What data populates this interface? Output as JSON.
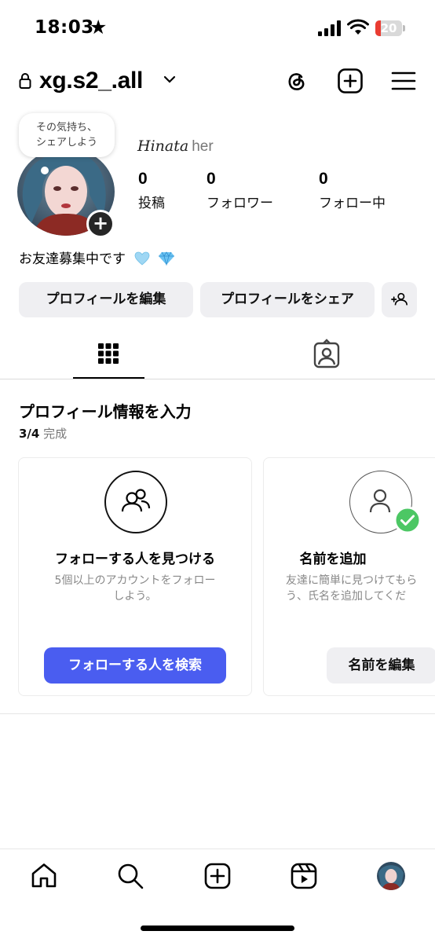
{
  "status_bar": {
    "time": "18:03",
    "battery": "20",
    "battery_level": 0.2
  },
  "header": {
    "username": "xg.s2_.all"
  },
  "profile": {
    "bubble_text": "その気持ち、\nシェアしよう",
    "display_name": "Hinata",
    "pronouns": "her",
    "stats": [
      {
        "value": "0",
        "label": "投稿"
      },
      {
        "value": "0",
        "label": "フォロワー"
      },
      {
        "value": "0",
        "label": "フォロー中"
      }
    ],
    "bio": "お友達募集中です",
    "buttons": {
      "edit": "プロフィールを編集",
      "share": "プロフィールをシェア"
    }
  },
  "completion": {
    "title": "プロフィール情報を入力",
    "progress": "3/4",
    "progress_suffix": "完成",
    "cards": [
      {
        "title": "フォローする人を見つける",
        "desc": "5個以上のアカウントをフォロー\nしよう。",
        "button": "フォローする人を検索"
      },
      {
        "title": "名前を追加",
        "desc": "友達に簡単に見つけてもら\nう、氏名を追加してくだ",
        "button": "名前を編集"
      }
    ]
  },
  "colors": {
    "primary_button": "#4a5df0",
    "check": "#4cc764",
    "battery": "#ea3c32"
  },
  "icons": [
    "lock-icon",
    "chevron-down-icon",
    "threads-icon",
    "add-post-icon",
    "menu-icon",
    "grid-icon",
    "tagged-icon",
    "home-icon",
    "search-icon",
    "create-icon",
    "reels-icon"
  ]
}
